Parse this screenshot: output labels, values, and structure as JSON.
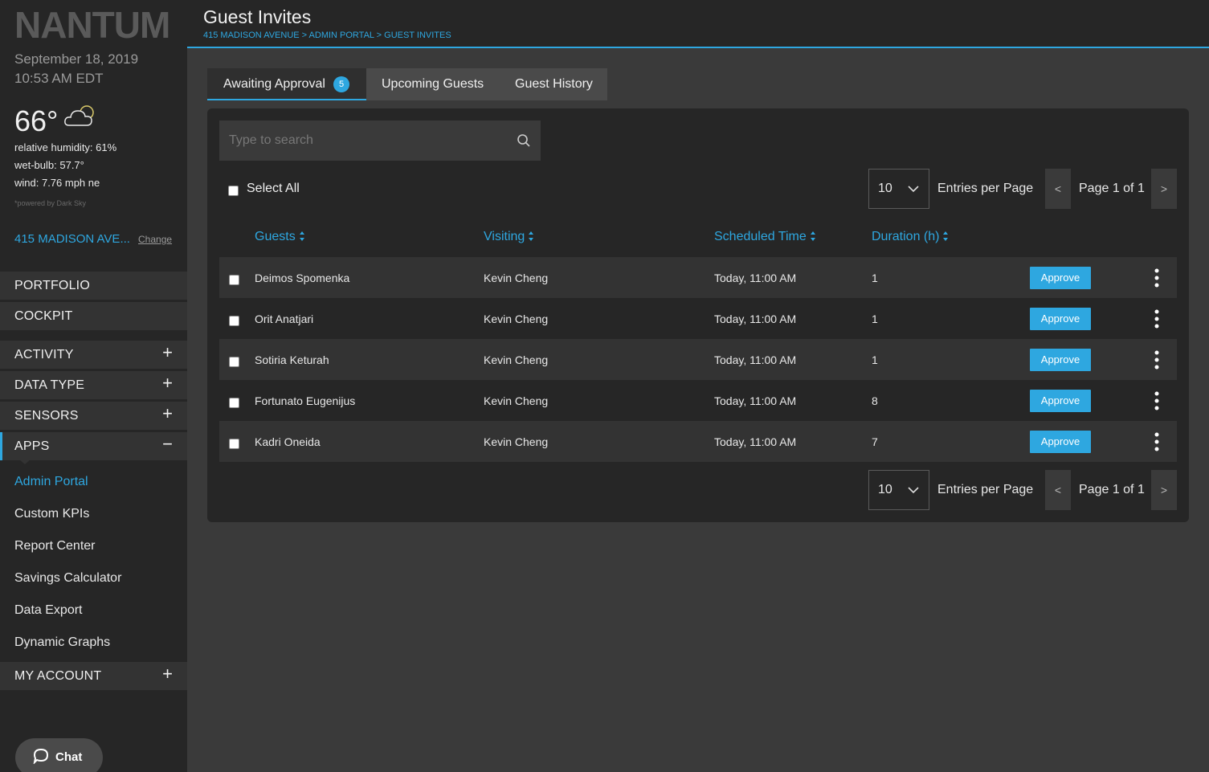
{
  "sidebar": {
    "logo_text": "NANTUM",
    "date": "September 18, 2019",
    "time": "10:53 AM EDT",
    "weather": {
      "temperature": "66°",
      "icon": "cloud-sun-icon",
      "humidity": "relative humidity: 61%",
      "wet_bulb": "wet-bulb: 57.7°",
      "wind": "wind: 7.76 mph ne",
      "powered_by": "*powered by Dark Sky"
    },
    "location": "415 MADISON AVE...",
    "change_label": "Change",
    "nav": [
      {
        "label": "PORTFOLIO",
        "toggle": ""
      },
      {
        "label": "COCKPIT",
        "toggle": ""
      },
      {
        "label": "ACTIVITY",
        "toggle": "+"
      },
      {
        "label": "DATA TYPE",
        "toggle": "+"
      },
      {
        "label": "SENSORS",
        "toggle": "+"
      },
      {
        "label": "APPS",
        "toggle": "−"
      },
      {
        "label": "MY ACCOUNT",
        "toggle": "+"
      }
    ],
    "apps_items": [
      "Admin Portal",
      "Custom KPIs",
      "Report Center",
      "Savings Calculator",
      "Data Export",
      "Dynamic Graphs"
    ],
    "chat_label": "Chat"
  },
  "header": {
    "title": "Guest Invites",
    "breadcrumb": "415 MADISON AVENUE > ADMIN PORTAL > GUEST INVITES"
  },
  "tabs": [
    {
      "label": "Awaiting Approval",
      "badge": "5"
    },
    {
      "label": "Upcoming Guests"
    },
    {
      "label": "Guest History"
    }
  ],
  "search": {
    "placeholder": "Type to search"
  },
  "select_all_label": "Select All",
  "pagination": {
    "entries_value": "10",
    "entries_label": "Entries per Page",
    "prev": "<",
    "next": ">",
    "page_label": "Page 1 of 1"
  },
  "columns": [
    "Guests",
    "Visiting",
    "Scheduled Time",
    "Duration (h)"
  ],
  "approve_label": "Approve",
  "rows": [
    {
      "guest": "Deimos Spomenka",
      "visiting": "Kevin Cheng",
      "time": "Today, 11:00 AM",
      "duration": "1"
    },
    {
      "guest": "Orit Anatjari",
      "visiting": "Kevin Cheng",
      "time": "Today, 11:00 AM",
      "duration": "1"
    },
    {
      "guest": "Sotiria Keturah",
      "visiting": "Kevin Cheng",
      "time": "Today, 11:00 AM",
      "duration": "1"
    },
    {
      "guest": "Fortunato Eugenijus",
      "visiting": "Kevin Cheng",
      "time": "Today, 11:00 AM",
      "duration": "8"
    },
    {
      "guest": "Kadri Oneida",
      "visiting": "Kevin Cheng",
      "time": "Today, 11:00 AM",
      "duration": "7"
    }
  ],
  "colors": {
    "accent": "#2ea7e0",
    "sidebar": "#262626",
    "background": "#3a3a3a"
  }
}
